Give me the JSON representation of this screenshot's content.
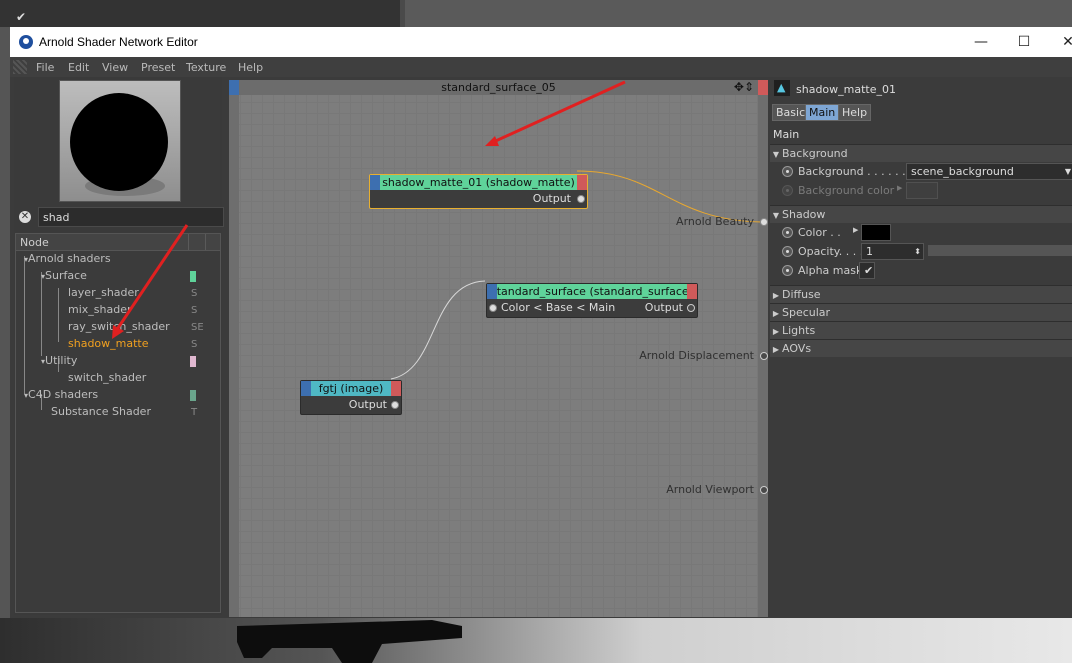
{
  "window": {
    "title": "Arnold Shader Network Editor"
  },
  "titlebar_controls": {
    "minimize": "—",
    "maximize": "☐",
    "close": "✕"
  },
  "background_app": {
    "checkmark": "✔"
  },
  "menu": [
    "File",
    "Edit",
    "View",
    "Preset",
    "Texture",
    "Help"
  ],
  "search": {
    "value": "shad",
    "clear": "✕"
  },
  "tree": {
    "header": "Node",
    "rows": [
      {
        "label": "Arnold shaders",
        "type": ""
      },
      {
        "label": "Surface",
        "type": ""
      },
      {
        "label": "layer_shader",
        "type": "S"
      },
      {
        "label": "mix_shader",
        "type": "S"
      },
      {
        "label": "ray_switch_shader",
        "type": "SE"
      },
      {
        "label": "shadow_matte",
        "type": "S"
      },
      {
        "label": "Utility",
        "type": ""
      },
      {
        "label": "switch_shader",
        "type": ""
      },
      {
        "label": "C4D shaders",
        "type": ""
      },
      {
        "label": "Substance Shader",
        "type": "T"
      }
    ],
    "swatch_colors": {
      "surface": "#5fd39a",
      "utility": "#e0b8d0",
      "c4d": "#6aa58c"
    }
  },
  "canvas": {
    "title": "standard_surface_05",
    "move_icon": "✥⇕",
    "nodes": {
      "shadow_matte": {
        "title": "shadow_matte_01 (shadow_matte)",
        "output": "Output",
        "color": "#5fd39a"
      },
      "standard_surface": {
        "title": "standard_surface (standard_surface)",
        "input": "Color < Base < Main",
        "output": "Output",
        "color": "#5fd39a"
      },
      "image": {
        "title": "fgtj (image)",
        "output": "Output",
        "color": "#4fb8c4"
      }
    },
    "outputs": {
      "beauty": "Arnold Beauty",
      "displacement": "Arnold Displacement",
      "viewport": "Arnold Viewport"
    },
    "annotation_arrow_color": "#e02020",
    "wire_colors": {
      "selected": "#e8a830",
      "normal": "#d8d8d8"
    }
  },
  "attributes": {
    "node_name": "shadow_matte_01",
    "tabs": [
      "Basic",
      "Main",
      "Help"
    ],
    "section": "Main",
    "groups": {
      "background": "Background",
      "shadow": "Shadow",
      "diffuse": "Diffuse",
      "specular": "Specular",
      "lights": "Lights",
      "aovs": "AOVs"
    },
    "background_label": "Background . . . . . . .",
    "background_value": "scene_background",
    "background_color_label": "Background color",
    "color_label": "Color . .",
    "color_value": "#000000",
    "opacity_label": "Opacity. . . .",
    "opacity_value": "1",
    "alpha_mask_label": "Alpha mask",
    "alpha_mask_check": "✔"
  }
}
